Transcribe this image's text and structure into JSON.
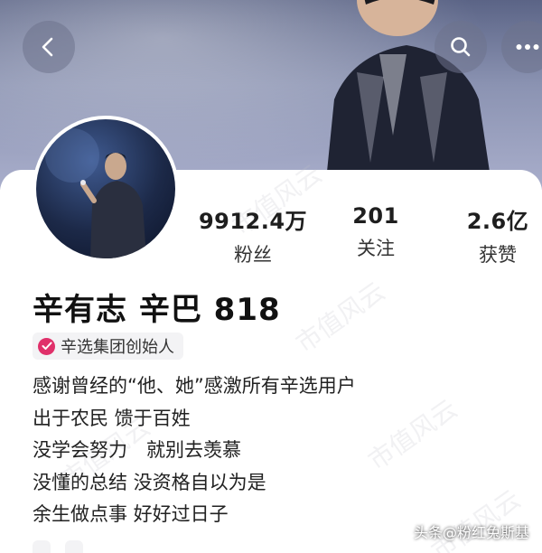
{
  "header": {
    "back_icon": "chevron-left-icon",
    "search_icon": "search-icon",
    "more_icon": "more-horizontal-icon"
  },
  "profile": {
    "name": "辛有志 辛巴 818",
    "verified_title": "辛选集团创始人",
    "stats": {
      "fans_value": "9912.4万",
      "fans_label": "粉丝",
      "following_value": "201",
      "following_label": "关注",
      "likes_value": "2.6亿",
      "likes_label": "获赞"
    },
    "bio_lines": [
      "感谢曾经的“他、她”感激所有辛选用户",
      "出于农民 馈于百姓",
      "没学会努力　就别去羡慕",
      "没懂的总结 没资格自以为是",
      "余生做点事 好好过日子"
    ]
  },
  "watermark_text": "市值风云",
  "credit": "头条@粉红兔斯基",
  "colors": {
    "verify_badge": "#e0306a",
    "cover": "#7a83a6"
  }
}
